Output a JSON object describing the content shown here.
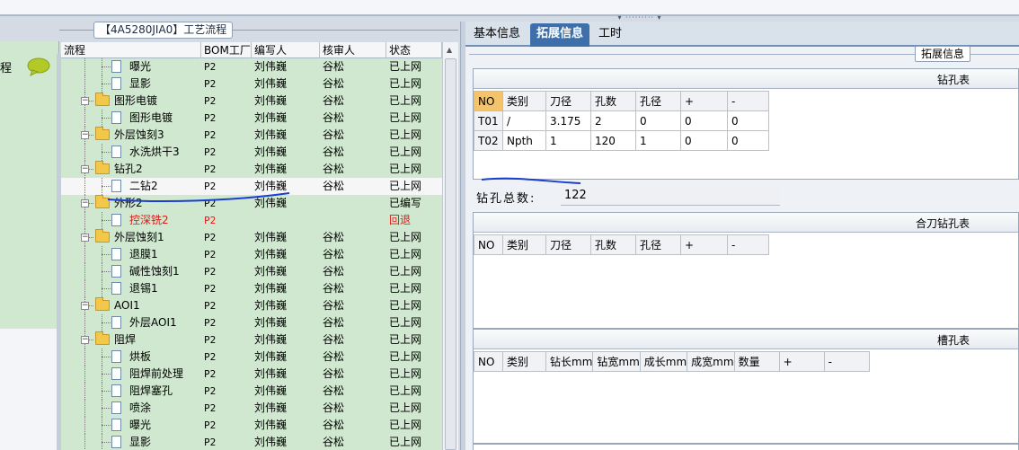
{
  "left_nav": {
    "label": "程"
  },
  "group": {
    "title": "【4A5280JIA0】工艺流程"
  },
  "tree": {
    "columns": [
      "流程",
      "BOM工厂",
      "编写人",
      "核审人",
      "状态"
    ],
    "rows": [
      {
        "level": 2,
        "type": "doc",
        "name": "曝光",
        "bom": "P2",
        "writer": "刘伟巍",
        "reviewer": "谷松",
        "status": "已上网"
      },
      {
        "level": 2,
        "type": "doc",
        "name": "显影",
        "bom": "P2",
        "writer": "刘伟巍",
        "reviewer": "谷松",
        "status": "已上网"
      },
      {
        "level": 1,
        "type": "folder",
        "name": "图形电镀",
        "bom": "P2",
        "writer": "刘伟巍",
        "reviewer": "谷松",
        "status": "已上网"
      },
      {
        "level": 2,
        "type": "doc",
        "name": "图形电镀",
        "bom": "P2",
        "writer": "刘伟巍",
        "reviewer": "谷松",
        "status": "已上网"
      },
      {
        "level": 1,
        "type": "folder",
        "name": "外层蚀刻3",
        "bom": "P2",
        "writer": "刘伟巍",
        "reviewer": "谷松",
        "status": "已上网"
      },
      {
        "level": 2,
        "type": "doc",
        "name": "水洗烘干3",
        "bom": "P2",
        "writer": "刘伟巍",
        "reviewer": "谷松",
        "status": "已上网"
      },
      {
        "level": 1,
        "type": "folder",
        "name": "钻孔2",
        "bom": "P2",
        "writer": "刘伟巍",
        "reviewer": "谷松",
        "status": "已上网"
      },
      {
        "level": 2,
        "type": "doc",
        "name": "二钻2",
        "bom": "P2",
        "writer": "刘伟巍",
        "reviewer": "谷松",
        "status": "已上网",
        "selected": true
      },
      {
        "level": 1,
        "type": "folder",
        "name": "外形2",
        "bom": "P2",
        "writer": "刘伟巍",
        "reviewer": "",
        "status": "已编写"
      },
      {
        "level": 2,
        "type": "doc",
        "name": "控深铣2",
        "bom": "P2",
        "writer": "",
        "reviewer": "",
        "status": "回退",
        "red": true
      },
      {
        "level": 1,
        "type": "folder",
        "name": "外层蚀刻1",
        "bom": "P2",
        "writer": "刘伟巍",
        "reviewer": "谷松",
        "status": "已上网"
      },
      {
        "level": 2,
        "type": "doc",
        "name": "退膜1",
        "bom": "P2",
        "writer": "刘伟巍",
        "reviewer": "谷松",
        "status": "已上网"
      },
      {
        "level": 2,
        "type": "doc",
        "name": "碱性蚀刻1",
        "bom": "P2",
        "writer": "刘伟巍",
        "reviewer": "谷松",
        "status": "已上网"
      },
      {
        "level": 2,
        "type": "doc",
        "name": "退锡1",
        "bom": "P2",
        "writer": "刘伟巍",
        "reviewer": "谷松",
        "status": "已上网"
      },
      {
        "level": 1,
        "type": "folder",
        "name": "AOI1",
        "bom": "P2",
        "writer": "刘伟巍",
        "reviewer": "谷松",
        "status": "已上网"
      },
      {
        "level": 2,
        "type": "doc",
        "name": "外层AOI1",
        "bom": "P2",
        "writer": "刘伟巍",
        "reviewer": "谷松",
        "status": "已上网"
      },
      {
        "level": 1,
        "type": "folder",
        "name": "阻焊",
        "bom": "P2",
        "writer": "刘伟巍",
        "reviewer": "谷松",
        "status": "已上网"
      },
      {
        "level": 2,
        "type": "doc",
        "name": "烘板",
        "bom": "P2",
        "writer": "刘伟巍",
        "reviewer": "谷松",
        "status": "已上网"
      },
      {
        "level": 2,
        "type": "doc",
        "name": "阻焊前处理",
        "bom": "P2",
        "writer": "刘伟巍",
        "reviewer": "谷松",
        "status": "已上网"
      },
      {
        "level": 2,
        "type": "doc",
        "name": "阻焊塞孔",
        "bom": "P2",
        "writer": "刘伟巍",
        "reviewer": "谷松",
        "status": "已上网"
      },
      {
        "level": 2,
        "type": "doc",
        "name": "喷涂",
        "bom": "P2",
        "writer": "刘伟巍",
        "reviewer": "谷松",
        "status": "已上网"
      },
      {
        "level": 2,
        "type": "doc",
        "name": "曝光",
        "bom": "P2",
        "writer": "刘伟巍",
        "reviewer": "谷松",
        "status": "已上网"
      },
      {
        "level": 2,
        "type": "doc",
        "name": "显影",
        "bom": "P2",
        "writer": "刘伟巍",
        "reviewer": "谷松",
        "status": "已上网"
      }
    ]
  },
  "tabs": [
    "基本信息",
    "拓展信息",
    "工时"
  ],
  "active_tab": 1,
  "ext_title": "拓展信息",
  "drill": {
    "title": "钻孔表",
    "columns": [
      "NO",
      "类别",
      "刀径",
      "孔数",
      "孔径",
      "+",
      "-"
    ],
    "rows": [
      [
        "T01",
        "/",
        "3.175",
        "2",
        "0",
        "0",
        "0"
      ],
      [
        "T02",
        "Npth",
        "1",
        "120",
        "1",
        "0",
        "0"
      ]
    ],
    "total_label": "钻孔总数:",
    "total_value": "122"
  },
  "combo": {
    "title": "合刀钻孔表",
    "columns": [
      "NO",
      "类别",
      "刀径",
      "孔数",
      "孔径",
      "+",
      "-"
    ]
  },
  "slot": {
    "title": "槽孔表",
    "columns": [
      "NO",
      "类别",
      "钻长mm",
      "钻宽mm",
      "成长mm",
      "成宽mm",
      "数量",
      "+",
      "-"
    ]
  },
  "colors": {
    "tree_bg": "#cfe8cf",
    "active_tab": "#3f6fa8",
    "return_status": "#e01818",
    "ink": "#1a3fd0"
  }
}
